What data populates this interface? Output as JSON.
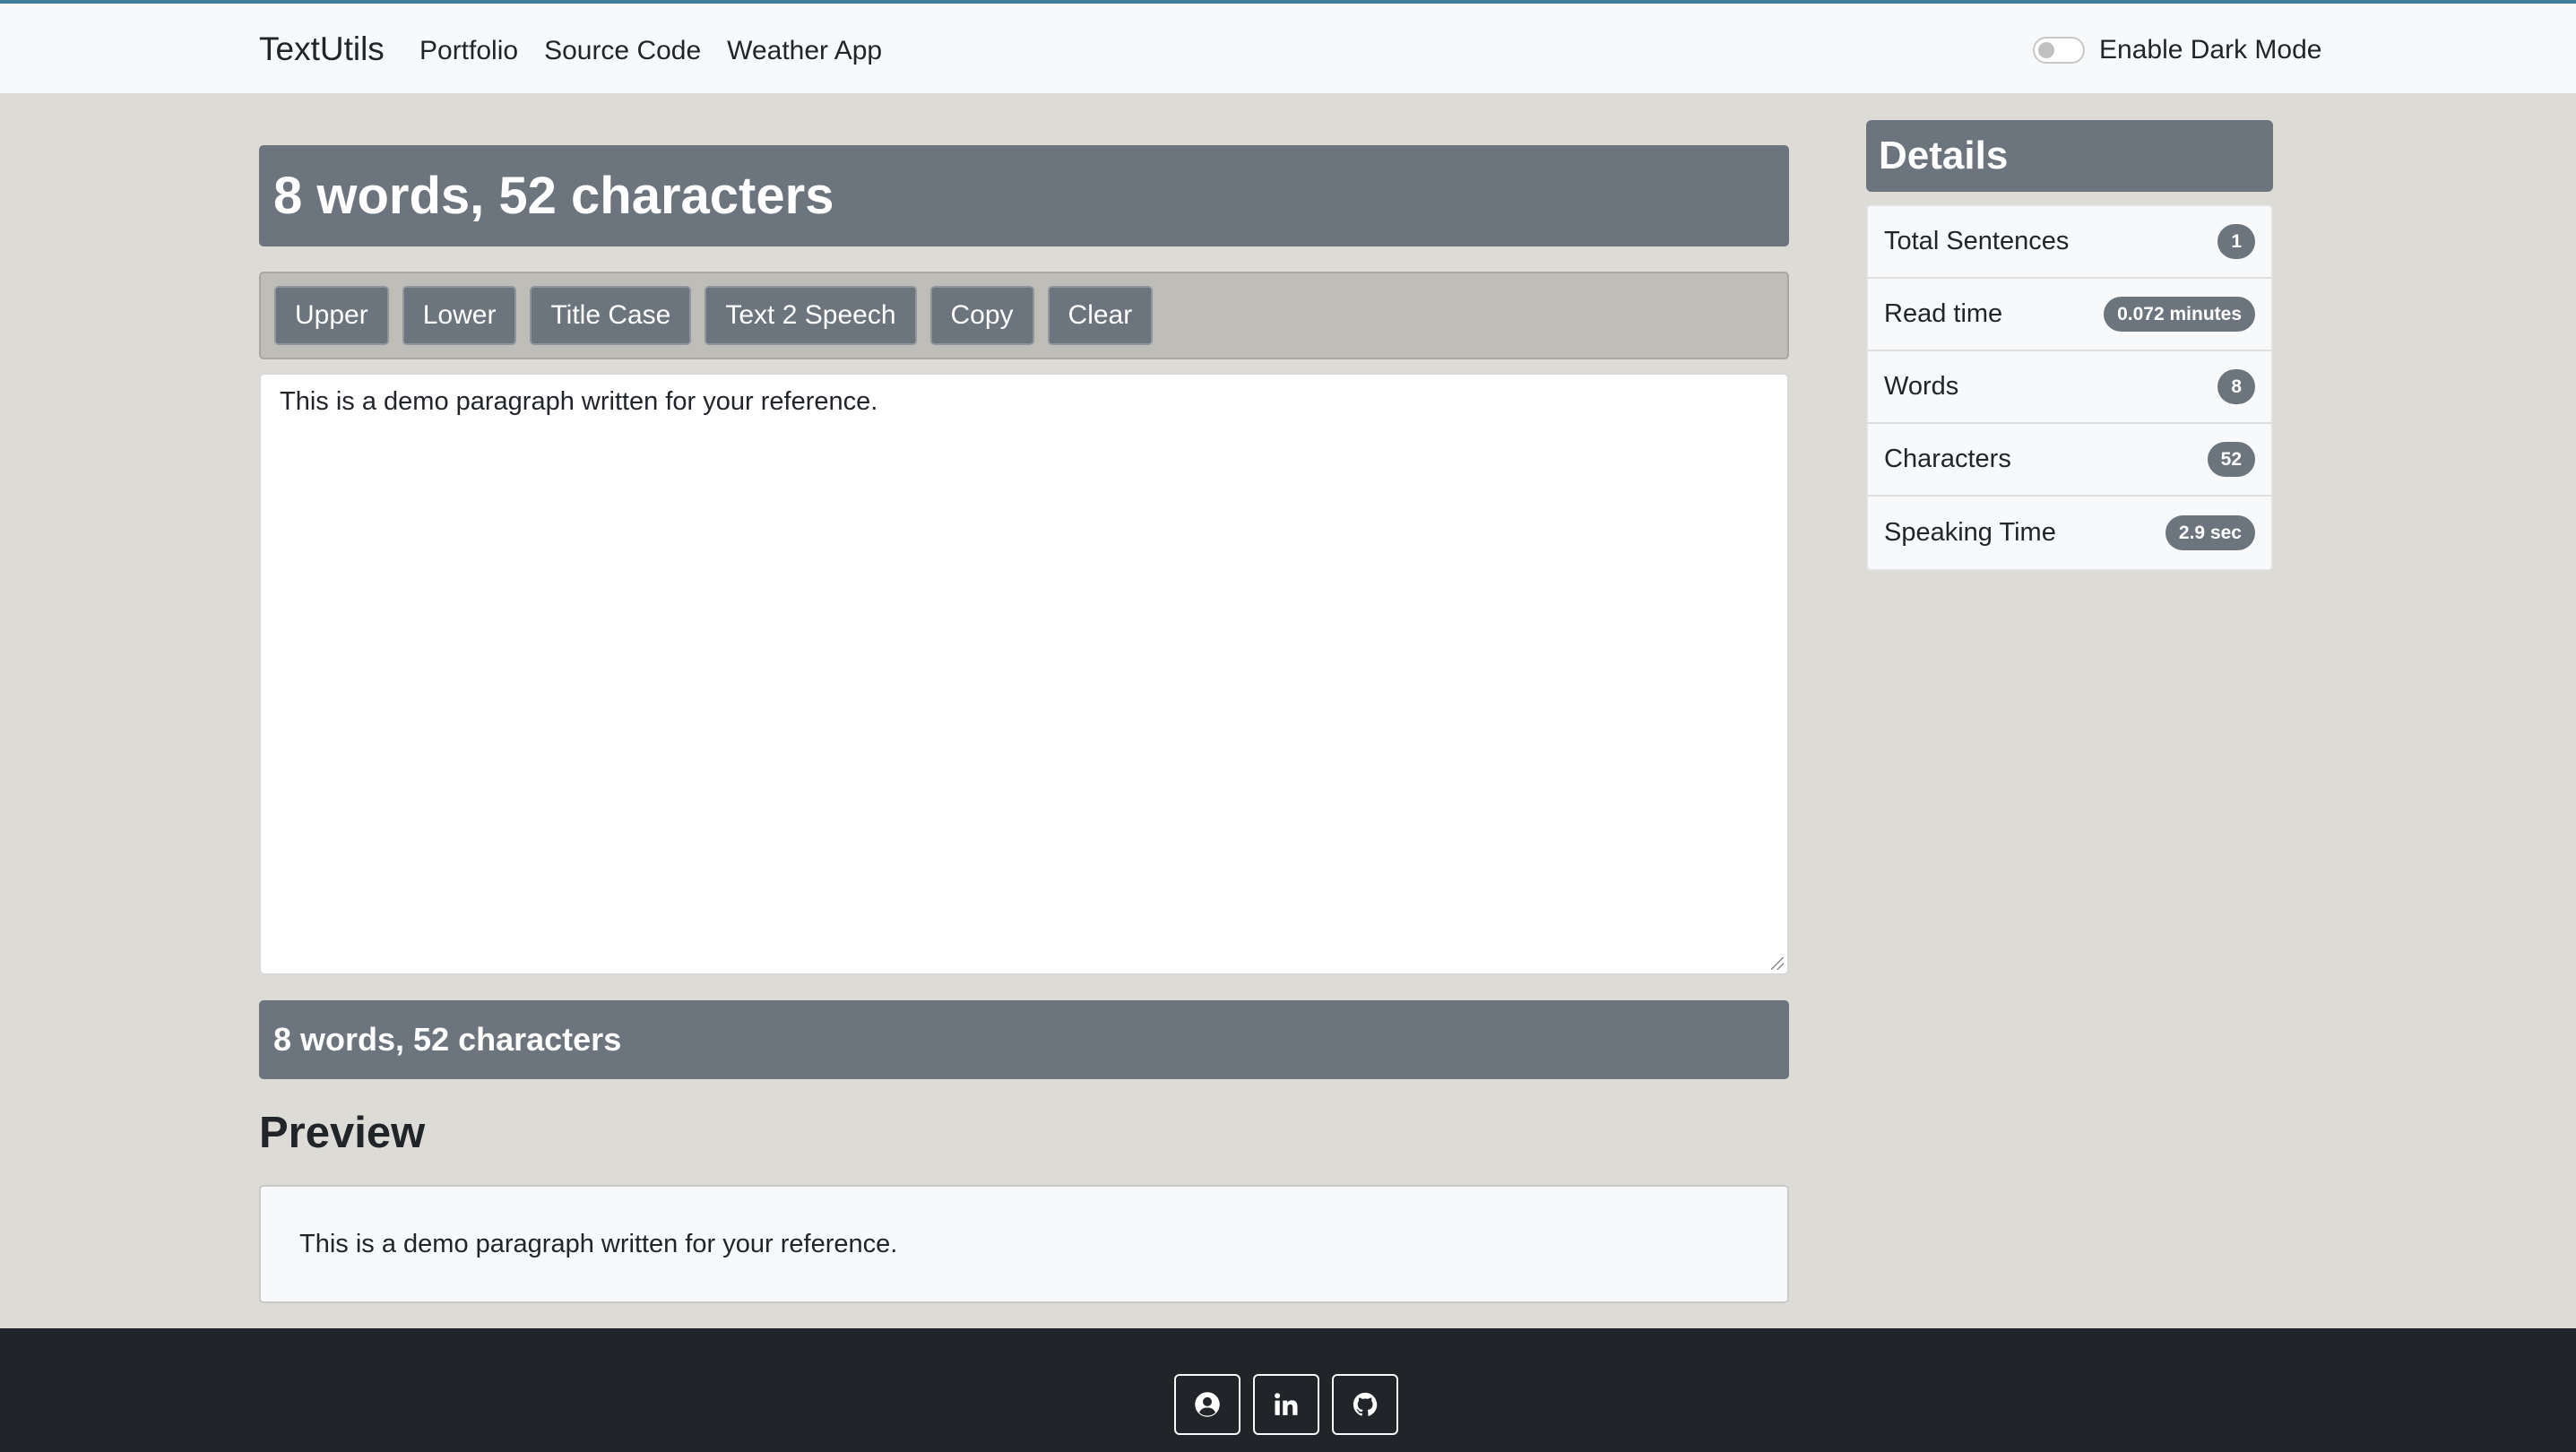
{
  "navbar": {
    "brand": "TextUtils",
    "links": [
      "Portfolio",
      "Source Code",
      "Weather App"
    ],
    "dark_mode_label": "Enable Dark Mode"
  },
  "main": {
    "header_title": "8 words, 52 characters",
    "buttons": [
      "Upper",
      "Lower",
      "Title Case",
      "Text 2 Speech",
      "Copy",
      "Clear"
    ],
    "textarea_value": "This is a demo paragraph written for your reference.",
    "summary": "8 words, 52 characters",
    "preview_heading": "Preview",
    "preview_text": "This is a demo paragraph written for your reference."
  },
  "details": {
    "title": "Details",
    "rows": [
      {
        "label": "Total Sentences",
        "value": "1"
      },
      {
        "label": "Read time",
        "value": "0.072 minutes"
      },
      {
        "label": "Words",
        "value": "8"
      },
      {
        "label": "Characters",
        "value": "52"
      },
      {
        "label": "Speaking Time",
        "value": "2.9 sec"
      }
    ]
  },
  "footer": {
    "icons": [
      "user-circle-icon",
      "linkedin-icon",
      "github-icon"
    ]
  },
  "colors": {
    "accent_gray": "#6c757d",
    "background": "#dcdbd6",
    "footer": "#212529",
    "navbar_top_border": "#3e7e99"
  }
}
